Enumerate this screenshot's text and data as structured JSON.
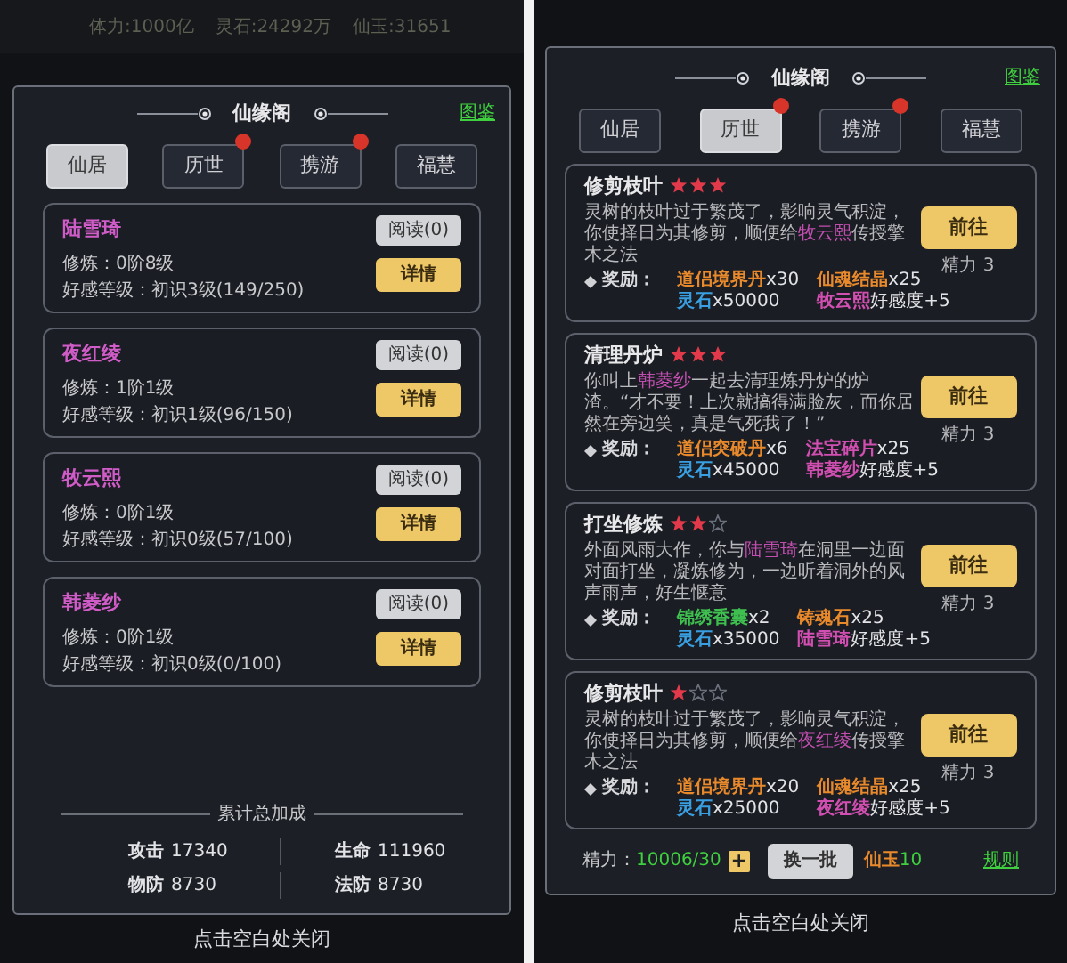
{
  "left": {
    "top_bar": {
      "stats": [
        "体力:1000亿",
        "灵石:24292万",
        "仙玉:31651"
      ]
    },
    "dialog": {
      "title": "仙缘阁",
      "link": "图鉴",
      "tabs": [
        {
          "label": "仙居",
          "selected": true,
          "badge": false
        },
        {
          "label": "历世",
          "selected": false,
          "badge": true
        },
        {
          "label": "携游",
          "selected": false,
          "badge": true
        },
        {
          "label": "福慧",
          "selected": false,
          "badge": false
        }
      ],
      "characters": [
        {
          "name": "陆雪琦",
          "read_button": "阅读(0)",
          "cultivation": "修炼：0阶8级",
          "favor": "好感等级：初识3级(149/250)",
          "detail_button": "详情"
        },
        {
          "name": "夜红绫",
          "read_button": "阅读(0)",
          "cultivation": "修炼：1阶1级",
          "favor": "好感等级：初识1级(96/150)",
          "detail_button": "详情"
        },
        {
          "name": "牧云熙",
          "read_button": "阅读(0)",
          "cultivation": "修炼：0阶1级",
          "favor": "好感等级：初识0级(57/100)",
          "detail_button": "详情"
        },
        {
          "name": "韩菱纱",
          "read_button": "阅读(0)",
          "cultivation": "修炼：0阶1级",
          "favor": "好感等级：初识0级(0/100)",
          "detail_button": "详情"
        }
      ],
      "totals": {
        "title": "累计总加成",
        "stats": [
          {
            "label": "攻击",
            "value": "17340"
          },
          {
            "label": "生命",
            "value": "111960"
          },
          {
            "label": "物防",
            "value": "8730"
          },
          {
            "label": "法防",
            "value": "8730"
          }
        ]
      }
    },
    "close_hint": "点击空白处关闭"
  },
  "right": {
    "dialog": {
      "title": "仙缘阁",
      "link": "图鉴",
      "tabs": [
        {
          "label": "仙居",
          "selected": false,
          "badge": false
        },
        {
          "label": "历世",
          "selected": true,
          "badge": true
        },
        {
          "label": "携游",
          "selected": false,
          "badge": true
        },
        {
          "label": "福慧",
          "selected": false,
          "badge": false
        }
      ],
      "tasks": [
        {
          "title": "修剪枝叶",
          "stars": 3,
          "description": [
            {
              "kind": "plain",
              "text": "灵树的枝叶过于繁茂了，影响灵气积淀，你使择日为其修剪，顺便给"
            },
            {
              "kind": "name",
              "text": "牧云熙"
            },
            {
              "kind": "plain",
              "text": "传授擎木之法"
            }
          ],
          "reward_label": "奖励：",
          "rewards": [
            {
              "name": "道侣境界丹",
              "suffix": "x30",
              "color": "#e8892c"
            },
            {
              "name": "仙魂结晶",
              "suffix": "x25",
              "color": "#e8892c"
            },
            {
              "name": "灵石",
              "suffix": "x50000",
              "color": "#3a9fe0"
            },
            {
              "name": "牧云熙",
              "suffix": "好感度+5",
              "color": "#d04fb0"
            }
          ],
          "go_button": "前往",
          "cost": "精力 3"
        },
        {
          "title": "清理丹炉",
          "stars": 3,
          "description": [
            {
              "kind": "plain",
              "text": "你叫上"
            },
            {
              "kind": "name",
              "text": "韩菱纱"
            },
            {
              "kind": "plain",
              "text": "一起去清理炼丹炉的炉渣。“才不要！上次就搞得满脸灰，而你居然在旁边笑，真是气死我了！”"
            }
          ],
          "reward_label": "奖励：",
          "rewards": [
            {
              "name": "道侣突破丹",
              "suffix": "x6",
              "color": "#e8892c"
            },
            {
              "name": "法宝碎片",
              "suffix": "x25",
              "color": "#d04fb0"
            },
            {
              "name": "灵石",
              "suffix": "x45000",
              "color": "#3a9fe0"
            },
            {
              "name": "韩菱纱",
              "suffix": "好感度+5",
              "color": "#d04fb0"
            }
          ],
          "go_button": "前往",
          "cost": "精力 3"
        },
        {
          "title": "打坐修炼",
          "stars": 2,
          "description": [
            {
              "kind": "plain",
              "text": "外面风雨大作，你与"
            },
            {
              "kind": "name",
              "text": "陆雪琦"
            },
            {
              "kind": "plain",
              "text": "在洞里一边面对面打坐，凝炼修为，一边听着洞外的风声雨声，好生惬意"
            }
          ],
          "reward_label": "奖励：",
          "rewards": [
            {
              "name": "锦绣香囊",
              "suffix": "x2",
              "color": "#3fbf4f"
            },
            {
              "name": "铸魂石",
              "suffix": "x25",
              "color": "#e8892c"
            },
            {
              "name": "灵石",
              "suffix": "x35000",
              "color": "#3a9fe0"
            },
            {
              "name": "陆雪琦",
              "suffix": "好感度+5",
              "color": "#d04fb0"
            }
          ],
          "go_button": "前往",
          "cost": "精力 3"
        },
        {
          "title": "修剪枝叶",
          "stars": 1,
          "description": [
            {
              "kind": "plain",
              "text": "灵树的枝叶过于繁茂了，影响灵气积淀，你使择日为其修剪，顺便给"
            },
            {
              "kind": "name",
              "text": "夜红绫"
            },
            {
              "kind": "plain",
              "text": "传授擎木之法"
            }
          ],
          "reward_label": "奖励：",
          "rewards": [
            {
              "name": "道侣境界丹",
              "suffix": "x20",
              "color": "#e8892c"
            },
            {
              "name": "仙魂结晶",
              "suffix": "x25",
              "color": "#e8892c"
            },
            {
              "name": "灵石",
              "suffix": "x25000",
              "color": "#3a9fe0"
            },
            {
              "name": "夜红绫",
              "suffix": "好感度+5",
              "color": "#d04fb0"
            }
          ],
          "go_button": "前往",
          "cost": "精力 3"
        }
      ],
      "footer": {
        "energy_label": "精力：",
        "energy_value": "10006/30",
        "plus": "+",
        "refresh_button": "换一批",
        "currency_label": "仙玉",
        "currency_value": "10",
        "rules_link": "规则"
      }
    },
    "close_hint": "点击空白处关闭"
  }
}
